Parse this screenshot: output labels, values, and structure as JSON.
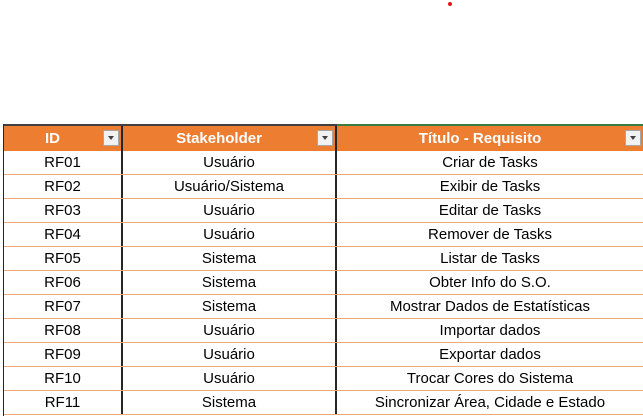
{
  "colors": {
    "header_bg": "#ed7d31",
    "header_text": "#ffffff",
    "row_border": "#f0a878",
    "marker": "#e8141c"
  },
  "table": {
    "headers": {
      "id": "ID",
      "stakeholder": "Stakeholder",
      "title": "Título - Requisito"
    },
    "filter_icon": "chevron-down-icon",
    "rows": [
      {
        "id": "RF01",
        "stakeholder": "Usuário",
        "title": "Criar de Tasks"
      },
      {
        "id": "RF02",
        "stakeholder": "Usuário/Sistema",
        "title": "Exibir de Tasks"
      },
      {
        "id": "RF03",
        "stakeholder": "Usuário",
        "title": "Editar de Tasks"
      },
      {
        "id": "RF04",
        "stakeholder": "Usuário",
        "title": "Remover de Tasks"
      },
      {
        "id": "RF05",
        "stakeholder": "Sistema",
        "title": "Listar de Tasks"
      },
      {
        "id": "RF06",
        "stakeholder": "Sistema",
        "title": "Obter Info do S.O."
      },
      {
        "id": "RF07",
        "stakeholder": "Sistema",
        "title": "Mostrar Dados de Estatísticas"
      },
      {
        "id": "RF08",
        "stakeholder": "Usuário",
        "title": "Importar dados"
      },
      {
        "id": "RF09",
        "stakeholder": "Usuário",
        "title": "Exportar dados"
      },
      {
        "id": "RF10",
        "stakeholder": "Usuário",
        "title": "Trocar Cores do Sistema"
      },
      {
        "id": "RF11",
        "stakeholder": "Sistema",
        "title": "Sincronizar Área, Cidade e Estado"
      }
    ]
  }
}
